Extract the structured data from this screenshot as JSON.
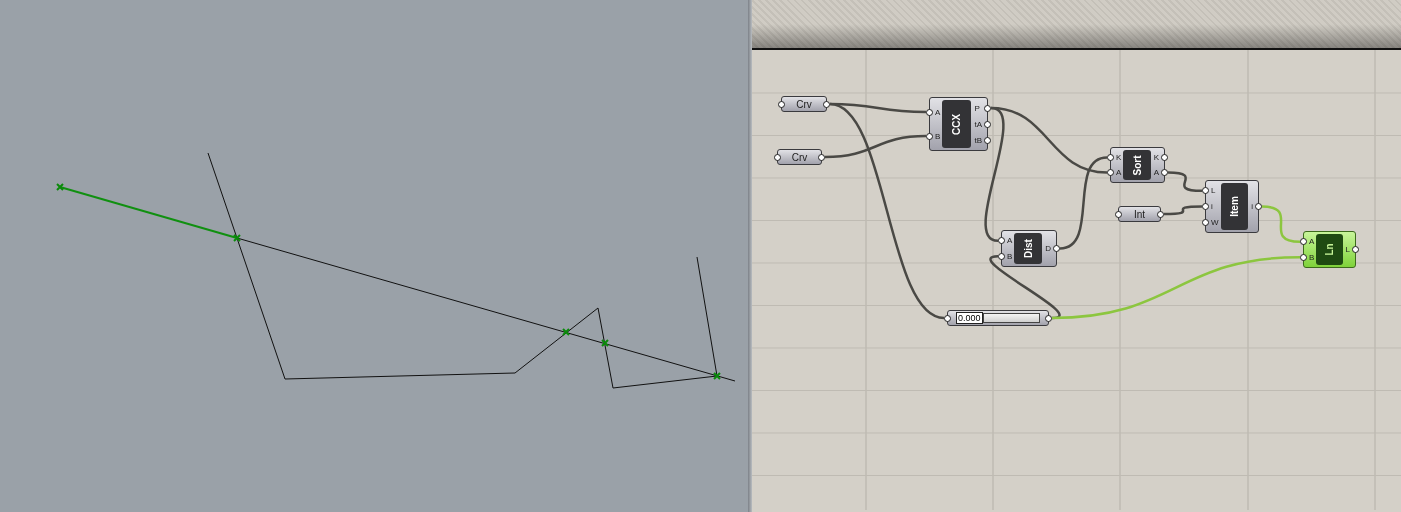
{
  "canvas": {
    "components": [
      {
        "kind": "param",
        "label": "Crv",
        "selected": false
      },
      {
        "kind": "param",
        "label": "Crv",
        "selected": false
      },
      {
        "kind": "component",
        "label": "CCX",
        "inputs": [
          "A",
          "B"
        ],
        "outputs": [
          "P",
          "tA",
          "tB"
        ],
        "selected": false
      },
      {
        "kind": "component",
        "label": "Dist",
        "inputs": [
          "A",
          "B"
        ],
        "outputs": [
          "D"
        ],
        "selected": false
      },
      {
        "kind": "component",
        "label": "Sort",
        "inputs": [
          "K",
          "A"
        ],
        "outputs": [
          "K",
          "A"
        ],
        "selected": false
      },
      {
        "kind": "param",
        "label": "Int",
        "selected": false
      },
      {
        "kind": "component",
        "label": "Item",
        "inputs": [
          "L",
          "i",
          "W"
        ],
        "outputs": [
          "i"
        ],
        "selected": false
      },
      {
        "kind": "slider",
        "value": "0.000",
        "selected": false
      },
      {
        "kind": "component",
        "label": "Ln",
        "inputs": [
          "A",
          "B"
        ],
        "outputs": [
          "L"
        ],
        "selected": true
      }
    ]
  }
}
